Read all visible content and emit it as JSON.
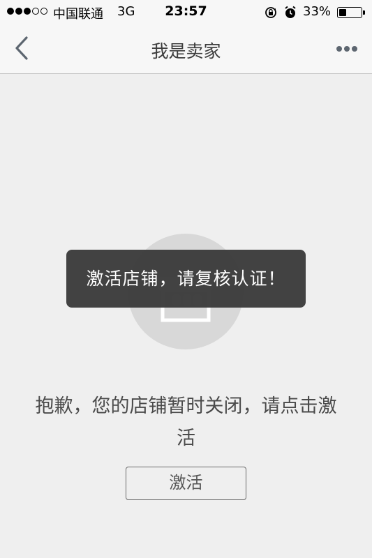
{
  "status_bar": {
    "signal_dots_filled": 3,
    "signal_dots_total": 5,
    "carrier": "中国联通",
    "network": "3G",
    "time": "23:57",
    "battery_percent_label": "33%",
    "battery_level": 0.33,
    "icons": [
      "rotation-lock-icon",
      "alarm-icon",
      "battery-icon"
    ]
  },
  "nav": {
    "title": "我是卖家",
    "back_icon": "chevron-left-icon",
    "more_icon": "ellipsis-icon"
  },
  "toast": {
    "text": "激活店铺，请复核认证！"
  },
  "main": {
    "message": "抱歉，您的店铺暂时关闭，请点击激活",
    "activate_label": "激活",
    "illustration_icon": "shop-closed-icon"
  },
  "colors": {
    "background": "#efefef",
    "bar_background": "#f7f7f7",
    "toast_background": "#3c3c3c",
    "text": "#4a4a4a"
  }
}
